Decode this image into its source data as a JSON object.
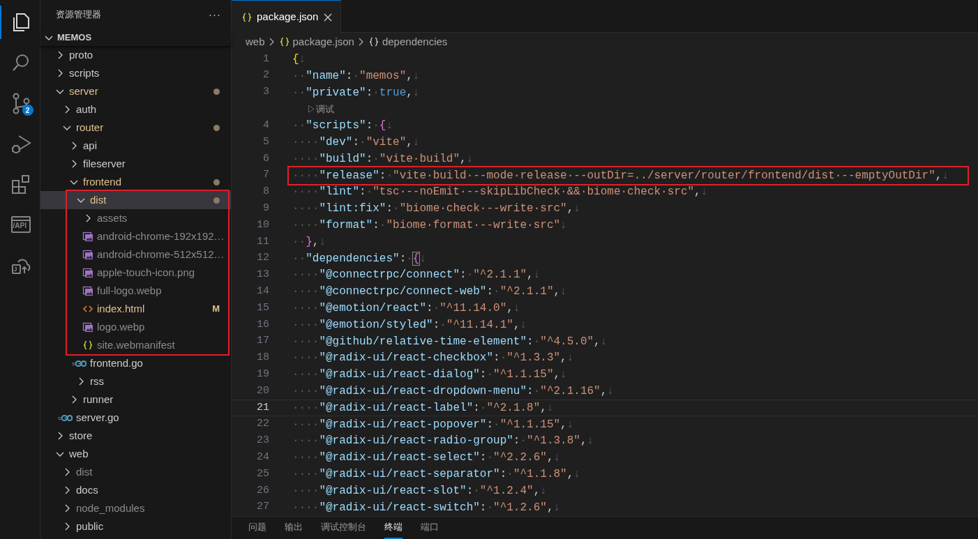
{
  "activity_bar": [
    {
      "kind": "files",
      "selected": true
    },
    {
      "kind": "search",
      "selected": false
    },
    {
      "kind": "source-control",
      "selected": false,
      "badge": "2"
    },
    {
      "kind": "run-debug",
      "selected": false
    },
    {
      "kind": "extensions",
      "selected": false
    },
    {
      "kind": "api",
      "selected": false,
      "label": "/API"
    },
    {
      "kind": "cloud",
      "selected": false,
      "label": "J"
    }
  ],
  "sidebar": {
    "title": "资源管理器",
    "more": "···",
    "root": {
      "name": "MEMOS",
      "expanded": true
    },
    "tree": [
      {
        "name": "proto",
        "kind": "folder",
        "expanded": false,
        "selected": false,
        "modified": false,
        "ignored": false,
        "dot": false
      },
      {
        "name": "scripts",
        "kind": "folder",
        "expanded": false,
        "selected": false,
        "modified": false,
        "ignored": false,
        "dot": false
      },
      {
        "name": "server",
        "kind": "folder",
        "expanded": true,
        "selected": false,
        "modified": true,
        "ignored": false,
        "dot": true,
        "children": [
          {
            "name": "auth",
            "kind": "folder",
            "expanded": false,
            "selected": false,
            "modified": false,
            "ignored": false,
            "dot": false
          },
          {
            "name": "router",
            "kind": "folder",
            "expanded": true,
            "selected": false,
            "modified": true,
            "ignored": false,
            "dot": true,
            "children": [
              {
                "name": "api",
                "kind": "folder",
                "expanded": false,
                "selected": false,
                "modified": false,
                "ignored": false,
                "dot": false
              },
              {
                "name": "fileserver",
                "kind": "folder",
                "expanded": false,
                "selected": false,
                "modified": false,
                "ignored": false,
                "dot": false
              },
              {
                "name": "frontend",
                "kind": "folder",
                "expanded": true,
                "selected": false,
                "modified": true,
                "ignored": false,
                "dot": true,
                "children": [
                  {
                    "name": "dist",
                    "kind": "folder",
                    "expanded": true,
                    "selected": true,
                    "modified": true,
                    "ignored": false,
                    "dot": true,
                    "children": [
                      {
                        "name": "assets",
                        "kind": "folder",
                        "expanded": false,
                        "selected": false,
                        "modified": false,
                        "ignored": true,
                        "dot": false
                      },
                      {
                        "name": "android-chrome-192x192…",
                        "kind": "image",
                        "selected": false,
                        "modified": false,
                        "ignored": true,
                        "dot": false
                      },
                      {
                        "name": "android-chrome-512x512…",
                        "kind": "image",
                        "selected": false,
                        "modified": false,
                        "ignored": true,
                        "dot": false
                      },
                      {
                        "name": "apple-touch-icon.png",
                        "kind": "image",
                        "selected": false,
                        "modified": false,
                        "ignored": true,
                        "dot": false
                      },
                      {
                        "name": "full-logo.webp",
                        "kind": "image",
                        "selected": false,
                        "modified": false,
                        "ignored": true,
                        "dot": false
                      },
                      {
                        "name": "index.html",
                        "kind": "html",
                        "selected": false,
                        "modified": true,
                        "ignored": false,
                        "dot": false,
                        "badge": "M"
                      },
                      {
                        "name": "logo.webp",
                        "kind": "image",
                        "selected": false,
                        "modified": false,
                        "ignored": true,
                        "dot": false
                      },
                      {
                        "name": "site.webmanifest",
                        "kind": "json",
                        "selected": false,
                        "modified": false,
                        "ignored": true,
                        "dot": false
                      }
                    ]
                  },
                  {
                    "name": "frontend.go",
                    "kind": "go",
                    "selected": false,
                    "modified": false,
                    "ignored": false,
                    "dot": false
                  },
                  {
                    "name": "rss",
                    "kind": "folder",
                    "expanded": false,
                    "selected": false,
                    "modified": false,
                    "ignored": false,
                    "dot": false
                  }
                ]
              },
              {
                "name": "runner",
                "kind": "folder",
                "expanded": false,
                "selected": false,
                "modified": false,
                "ignored": false,
                "dot": false
              }
            ]
          },
          {
            "name": "server.go",
            "kind": "go",
            "selected": false,
            "modified": false,
            "ignored": false,
            "dot": false
          }
        ]
      },
      {
        "name": "store",
        "kind": "folder",
        "expanded": false,
        "selected": false,
        "modified": false,
        "ignored": false,
        "dot": false
      },
      {
        "name": "web",
        "kind": "folder",
        "expanded": true,
        "selected": false,
        "modified": false,
        "ignored": false,
        "dot": false,
        "children": [
          {
            "name": "dist",
            "kind": "folder",
            "expanded": false,
            "selected": false,
            "modified": false,
            "ignored": true,
            "dot": false
          },
          {
            "name": "docs",
            "kind": "folder",
            "expanded": false,
            "selected": false,
            "modified": false,
            "ignored": false,
            "dot": false
          },
          {
            "name": "node_modules",
            "kind": "folder",
            "expanded": false,
            "selected": false,
            "modified": false,
            "ignored": true,
            "dot": false
          },
          {
            "name": "public",
            "kind": "folder",
            "expanded": false,
            "selected": false,
            "modified": false,
            "ignored": false,
            "dot": false
          }
        ]
      }
    ]
  },
  "tabs": [
    {
      "label": "package.json",
      "kind": "json",
      "selected": true
    }
  ],
  "breadcrumb": [
    {
      "label": "web",
      "kind": "folder"
    },
    {
      "label": "package.json",
      "kind": "json"
    },
    {
      "label": "dependencies",
      "kind": "object"
    }
  ],
  "editor": {
    "lines": [
      {
        "kind": "line",
        "n": "1",
        "current": false,
        "tokens": [
          {
            "kind": "brace1",
            "text": "{"
          },
          {
            "kind": "space",
            "text": "↓"
          }
        ]
      },
      {
        "kind": "line",
        "n": "2",
        "current": false,
        "tokens": [
          {
            "kind": "space",
            "text": "··"
          },
          {
            "kind": "key",
            "text": "\"name\""
          },
          {
            "kind": "punct",
            "text": ":"
          },
          {
            "kind": "space",
            "text": "·"
          },
          {
            "kind": "string",
            "text": "\"memos\""
          },
          {
            "kind": "punct",
            "text": ","
          },
          {
            "kind": "space",
            "text": "↓"
          }
        ]
      },
      {
        "kind": "line",
        "n": "3",
        "current": false,
        "tokens": [
          {
            "kind": "space",
            "text": "··"
          },
          {
            "kind": "key",
            "text": "\"private\""
          },
          {
            "kind": "punct",
            "text": ":"
          },
          {
            "kind": "space",
            "text": "·"
          },
          {
            "kind": "literal",
            "text": "true"
          },
          {
            "kind": "punct",
            "text": ","
          },
          {
            "kind": "space",
            "text": "↓"
          }
        ]
      },
      {
        "kind": "codelens",
        "text": "▷调试"
      },
      {
        "kind": "line",
        "n": "4",
        "current": false,
        "tokens": [
          {
            "kind": "space",
            "text": "··"
          },
          {
            "kind": "key",
            "text": "\"scripts\""
          },
          {
            "kind": "punct",
            "text": ":"
          },
          {
            "kind": "space",
            "text": "·"
          },
          {
            "kind": "brace2",
            "text": "{"
          },
          {
            "kind": "space",
            "text": "↓"
          }
        ]
      },
      {
        "kind": "line",
        "n": "5",
        "current": false,
        "tokens": [
          {
            "kind": "space",
            "text": "····"
          },
          {
            "kind": "key",
            "text": "\"dev\""
          },
          {
            "kind": "punct",
            "text": ":"
          },
          {
            "kind": "space",
            "text": "·"
          },
          {
            "kind": "string",
            "text": "\"vite\""
          },
          {
            "kind": "punct",
            "text": ","
          },
          {
            "kind": "space",
            "text": "↓"
          }
        ]
      },
      {
        "kind": "line",
        "n": "6",
        "current": false,
        "tokens": [
          {
            "kind": "space",
            "text": "····"
          },
          {
            "kind": "key",
            "text": "\"build\""
          },
          {
            "kind": "punct",
            "text": ":"
          },
          {
            "kind": "space",
            "text": "·"
          },
          {
            "kind": "string",
            "text": "\"vite·build\""
          },
          {
            "kind": "punct",
            "text": ","
          },
          {
            "kind": "space",
            "text": "↓"
          }
        ]
      },
      {
        "kind": "line",
        "n": "7",
        "current": false,
        "boxed": true,
        "tokens": [
          {
            "kind": "space",
            "text": "····"
          },
          {
            "kind": "key",
            "text": "\"release\""
          },
          {
            "kind": "punct",
            "text": ":"
          },
          {
            "kind": "space",
            "text": "·"
          },
          {
            "kind": "string",
            "text": "\"vite·build·--mode·release·--outDir=../server/router/frontend/dist·--emptyOutDir\""
          },
          {
            "kind": "punct",
            "text": ","
          },
          {
            "kind": "space",
            "text": "↓"
          }
        ]
      },
      {
        "kind": "line",
        "n": "8",
        "current": false,
        "tokens": [
          {
            "kind": "space",
            "text": "····"
          },
          {
            "kind": "key",
            "text": "\"lint\""
          },
          {
            "kind": "punct",
            "text": ":"
          },
          {
            "kind": "space",
            "text": "·"
          },
          {
            "kind": "string",
            "text": "\"tsc·--noEmit·--skipLibCheck·&&·biome·check·src\""
          },
          {
            "kind": "punct",
            "text": ","
          },
          {
            "kind": "space",
            "text": "↓"
          }
        ]
      },
      {
        "kind": "line",
        "n": "9",
        "current": false,
        "tokens": [
          {
            "kind": "space",
            "text": "····"
          },
          {
            "kind": "key",
            "text": "\"lint:fix\""
          },
          {
            "kind": "punct",
            "text": ":"
          },
          {
            "kind": "space",
            "text": "·"
          },
          {
            "kind": "string",
            "text": "\"biome·check·--write·src\""
          },
          {
            "kind": "punct",
            "text": ","
          },
          {
            "kind": "space",
            "text": "↓"
          }
        ]
      },
      {
        "kind": "line",
        "n": "10",
        "current": false,
        "tokens": [
          {
            "kind": "space",
            "text": "····"
          },
          {
            "kind": "key",
            "text": "\"format\""
          },
          {
            "kind": "punct",
            "text": ":"
          },
          {
            "kind": "space",
            "text": "·"
          },
          {
            "kind": "string",
            "text": "\"biome·format·--write·src\""
          },
          {
            "kind": "space",
            "text": "↓"
          }
        ]
      },
      {
        "kind": "line",
        "n": "11",
        "current": false,
        "tokens": [
          {
            "kind": "space",
            "text": "··"
          },
          {
            "kind": "brace2",
            "text": "}"
          },
          {
            "kind": "punct",
            "text": ","
          },
          {
            "kind": "space",
            "text": "↓"
          }
        ]
      },
      {
        "kind": "line",
        "n": "12",
        "current": false,
        "tokens": [
          {
            "kind": "space",
            "text": "··"
          },
          {
            "kind": "key",
            "text": "\"dependencies\""
          },
          {
            "kind": "punct",
            "text": ":"
          },
          {
            "kind": "space",
            "text": "·"
          },
          {
            "kind": "brace-match",
            "text": "{"
          },
          {
            "kind": "space",
            "text": "↓"
          }
        ]
      },
      {
        "kind": "line",
        "n": "13",
        "current": false,
        "tokens": [
          {
            "kind": "space",
            "text": "····"
          },
          {
            "kind": "key",
            "text": "\"@connectrpc/connect\""
          },
          {
            "kind": "punct",
            "text": ":"
          },
          {
            "kind": "space",
            "text": "·"
          },
          {
            "kind": "string",
            "text": "\"^2.1.1\""
          },
          {
            "kind": "punct",
            "text": ","
          },
          {
            "kind": "space",
            "text": "↓"
          }
        ]
      },
      {
        "kind": "line",
        "n": "14",
        "current": false,
        "tokens": [
          {
            "kind": "space",
            "text": "····"
          },
          {
            "kind": "key",
            "text": "\"@connectrpc/connect-web\""
          },
          {
            "kind": "punct",
            "text": ":"
          },
          {
            "kind": "space",
            "text": "·"
          },
          {
            "kind": "string",
            "text": "\"^2.1.1\""
          },
          {
            "kind": "punct",
            "text": ","
          },
          {
            "kind": "space",
            "text": "↓"
          }
        ]
      },
      {
        "kind": "line",
        "n": "15",
        "current": false,
        "tokens": [
          {
            "kind": "space",
            "text": "····"
          },
          {
            "kind": "key",
            "text": "\"@emotion/react\""
          },
          {
            "kind": "punct",
            "text": ":"
          },
          {
            "kind": "space",
            "text": "·"
          },
          {
            "kind": "string",
            "text": "\"^11.14.0\""
          },
          {
            "kind": "punct",
            "text": ","
          },
          {
            "kind": "space",
            "text": "↓"
          }
        ]
      },
      {
        "kind": "line",
        "n": "16",
        "current": false,
        "tokens": [
          {
            "kind": "space",
            "text": "····"
          },
          {
            "kind": "key",
            "text": "\"@emotion/styled\""
          },
          {
            "kind": "punct",
            "text": ":"
          },
          {
            "kind": "space",
            "text": "·"
          },
          {
            "kind": "string",
            "text": "\"^11.14.1\""
          },
          {
            "kind": "punct",
            "text": ","
          },
          {
            "kind": "space",
            "text": "↓"
          }
        ]
      },
      {
        "kind": "line",
        "n": "17",
        "current": false,
        "tokens": [
          {
            "kind": "space",
            "text": "····"
          },
          {
            "kind": "key",
            "text": "\"@github/relative-time-element\""
          },
          {
            "kind": "punct",
            "text": ":"
          },
          {
            "kind": "space",
            "text": "·"
          },
          {
            "kind": "string",
            "text": "\"^4.5.0\""
          },
          {
            "kind": "punct",
            "text": ","
          },
          {
            "kind": "space",
            "text": "↓"
          }
        ]
      },
      {
        "kind": "line",
        "n": "18",
        "current": false,
        "tokens": [
          {
            "kind": "space",
            "text": "····"
          },
          {
            "kind": "key",
            "text": "\"@radix-ui/react-checkbox\""
          },
          {
            "kind": "punct",
            "text": ":"
          },
          {
            "kind": "space",
            "text": "·"
          },
          {
            "kind": "string",
            "text": "\"^1.3.3\""
          },
          {
            "kind": "punct",
            "text": ","
          },
          {
            "kind": "space",
            "text": "↓"
          }
        ]
      },
      {
        "kind": "line",
        "n": "19",
        "current": false,
        "tokens": [
          {
            "kind": "space",
            "text": "····"
          },
          {
            "kind": "key",
            "text": "\"@radix-ui/react-dialog\""
          },
          {
            "kind": "punct",
            "text": ":"
          },
          {
            "kind": "space",
            "text": "·"
          },
          {
            "kind": "string",
            "text": "\"^1.1.15\""
          },
          {
            "kind": "punct",
            "text": ","
          },
          {
            "kind": "space",
            "text": "↓"
          }
        ]
      },
      {
        "kind": "line",
        "n": "20",
        "current": false,
        "tokens": [
          {
            "kind": "space",
            "text": "····"
          },
          {
            "kind": "key",
            "text": "\"@radix-ui/react-dropdown-menu\""
          },
          {
            "kind": "punct",
            "text": ":"
          },
          {
            "kind": "space",
            "text": "·"
          },
          {
            "kind": "string",
            "text": "\"^2.1.16\""
          },
          {
            "kind": "punct",
            "text": ","
          },
          {
            "kind": "space",
            "text": "↓"
          }
        ]
      },
      {
        "kind": "line",
        "n": "21",
        "current": true,
        "tokens": [
          {
            "kind": "space",
            "text": "····"
          },
          {
            "kind": "key",
            "text": "\"@radix-ui/react-label\""
          },
          {
            "kind": "punct",
            "text": ":"
          },
          {
            "kind": "space",
            "text": "·"
          },
          {
            "kind": "string",
            "text": "\"^2.1.8\""
          },
          {
            "kind": "punct",
            "text": ","
          },
          {
            "kind": "space",
            "text": "↓"
          }
        ]
      },
      {
        "kind": "line",
        "n": "22",
        "current": false,
        "tokens": [
          {
            "kind": "space",
            "text": "····"
          },
          {
            "kind": "key",
            "text": "\"@radix-ui/react-popover\""
          },
          {
            "kind": "punct",
            "text": ":"
          },
          {
            "kind": "space",
            "text": "·"
          },
          {
            "kind": "string",
            "text": "\"^1.1.15\""
          },
          {
            "kind": "punct",
            "text": ","
          },
          {
            "kind": "space",
            "text": "↓"
          }
        ]
      },
      {
        "kind": "line",
        "n": "23",
        "current": false,
        "tokens": [
          {
            "kind": "space",
            "text": "····"
          },
          {
            "kind": "key",
            "text": "\"@radix-ui/react-radio-group\""
          },
          {
            "kind": "punct",
            "text": ":"
          },
          {
            "kind": "space",
            "text": "·"
          },
          {
            "kind": "string",
            "text": "\"^1.3.8\""
          },
          {
            "kind": "punct",
            "text": ","
          },
          {
            "kind": "space",
            "text": "↓"
          }
        ]
      },
      {
        "kind": "line",
        "n": "24",
        "current": false,
        "tokens": [
          {
            "kind": "space",
            "text": "····"
          },
          {
            "kind": "key",
            "text": "\"@radix-ui/react-select\""
          },
          {
            "kind": "punct",
            "text": ":"
          },
          {
            "kind": "space",
            "text": "·"
          },
          {
            "kind": "string",
            "text": "\"^2.2.6\""
          },
          {
            "kind": "punct",
            "text": ","
          },
          {
            "kind": "space",
            "text": "↓"
          }
        ]
      },
      {
        "kind": "line",
        "n": "25",
        "current": false,
        "tokens": [
          {
            "kind": "space",
            "text": "····"
          },
          {
            "kind": "key",
            "text": "\"@radix-ui/react-separator\""
          },
          {
            "kind": "punct",
            "text": ":"
          },
          {
            "kind": "space",
            "text": "·"
          },
          {
            "kind": "string",
            "text": "\"^1.1.8\""
          },
          {
            "kind": "punct",
            "text": ","
          },
          {
            "kind": "space",
            "text": "↓"
          }
        ]
      },
      {
        "kind": "line",
        "n": "26",
        "current": false,
        "tokens": [
          {
            "kind": "space",
            "text": "····"
          },
          {
            "kind": "key",
            "text": "\"@radix-ui/react-slot\""
          },
          {
            "kind": "punct",
            "text": ":"
          },
          {
            "kind": "space",
            "text": "·"
          },
          {
            "kind": "string",
            "text": "\"^1.2.4\""
          },
          {
            "kind": "punct",
            "text": ","
          },
          {
            "kind": "space",
            "text": "↓"
          }
        ]
      },
      {
        "kind": "line",
        "n": "27",
        "current": false,
        "tokens": [
          {
            "kind": "space",
            "text": "····"
          },
          {
            "kind": "key",
            "text": "\"@radix-ui/react-switch\""
          },
          {
            "kind": "punct",
            "text": ":"
          },
          {
            "kind": "space",
            "text": "·"
          },
          {
            "kind": "string",
            "text": "\"^1.2.6\""
          },
          {
            "kind": "punct",
            "text": ","
          },
          {
            "kind": "space",
            "text": "↓"
          }
        ]
      }
    ]
  },
  "panel_tabs": [
    {
      "label": "问题",
      "selected": false
    },
    {
      "label": "输出",
      "selected": false
    },
    {
      "label": "调试控制台",
      "selected": false
    },
    {
      "label": "终端",
      "selected": true
    },
    {
      "label": "端口",
      "selected": false
    }
  ]
}
